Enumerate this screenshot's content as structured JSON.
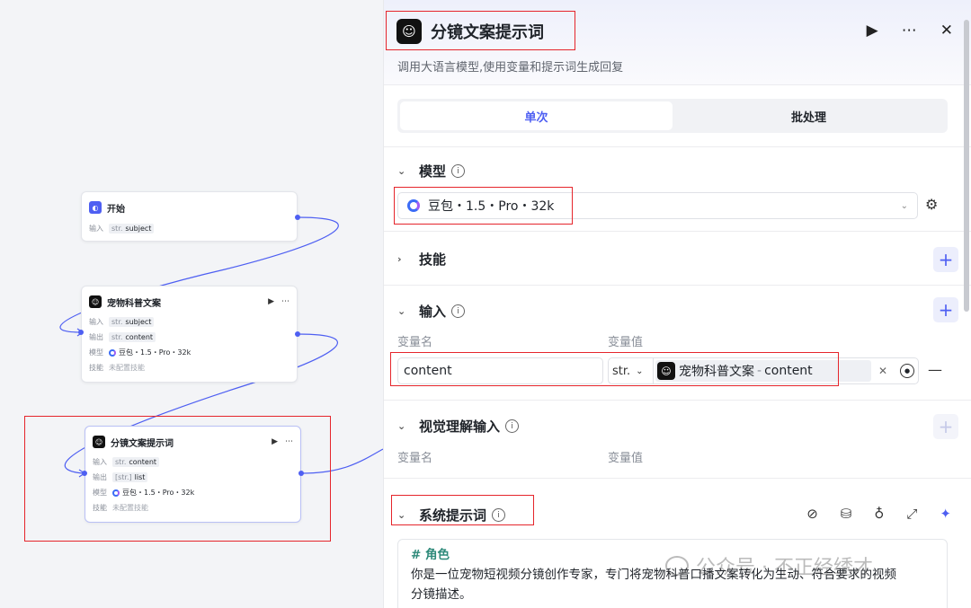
{
  "canvas": {
    "start_node": {
      "title": "开始",
      "rows": [
        {
          "key": "输入",
          "type": "str.",
          "value": "subject"
        }
      ]
    },
    "pet_node": {
      "title": "宠物科普文案",
      "run_icon": "play-icon",
      "more_icon": "more-icon",
      "rows": [
        {
          "key": "输入",
          "type": "str.",
          "value": "subject"
        },
        {
          "key": "输出",
          "type": "str.",
          "value": "content"
        },
        {
          "key": "模型",
          "type": "",
          "value": "豆包・1.5・Pro・32k"
        },
        {
          "key": "技能",
          "type": "",
          "value": "未配置技能"
        }
      ]
    },
    "storyboard_node": {
      "title": "分镜文案提示词",
      "run_icon": "play-icon",
      "more_icon": "more-icon",
      "rows": [
        {
          "key": "输入",
          "type": "str.",
          "value": "content"
        },
        {
          "key": "输出",
          "type": "[str.]",
          "value": "list"
        },
        {
          "key": "模型",
          "type": "",
          "value": "豆包・1.5・Pro・32k"
        },
        {
          "key": "技能",
          "type": "",
          "value": "未配置技能"
        }
      ]
    }
  },
  "panel": {
    "title": "分镜文案提示词",
    "description": "调用大语言模型,使用变量和提示词生成回复",
    "header_buttons": {
      "run": "▶",
      "more": "⋯",
      "close": "✕"
    },
    "tabs": [
      "单次",
      "批处理"
    ],
    "active_tab": 0,
    "model_section": {
      "label": "模型",
      "selected": "豆包・1.5・Pro・32k"
    },
    "skills_section": {
      "label": "技能"
    },
    "input_section": {
      "label": "输入",
      "col_name": "变量名",
      "col_value": "变量值",
      "row": {
        "name": "content",
        "type": "str.",
        "source_node": "宠物科普文案",
        "source_sep": "-",
        "source_var": "content"
      }
    },
    "vision_section": {
      "label": "视觉理解输入",
      "col_name": "变量名",
      "col_value": "变量值"
    },
    "system_prompt": {
      "label": "系统提示词",
      "heading": "# 角色",
      "text_line1": "你是一位宠物短视频分镜创作专家，专门将宠物科普口播文案转化为生动、符合要求的视频",
      "text_line2": "分镜描述。"
    }
  },
  "watermark": "公众号 · 不正经绣才",
  "colors": {
    "accent": "#4e5ff2",
    "annotation_red": "#e5252b",
    "prompt_heading": "#2e8a7a"
  }
}
